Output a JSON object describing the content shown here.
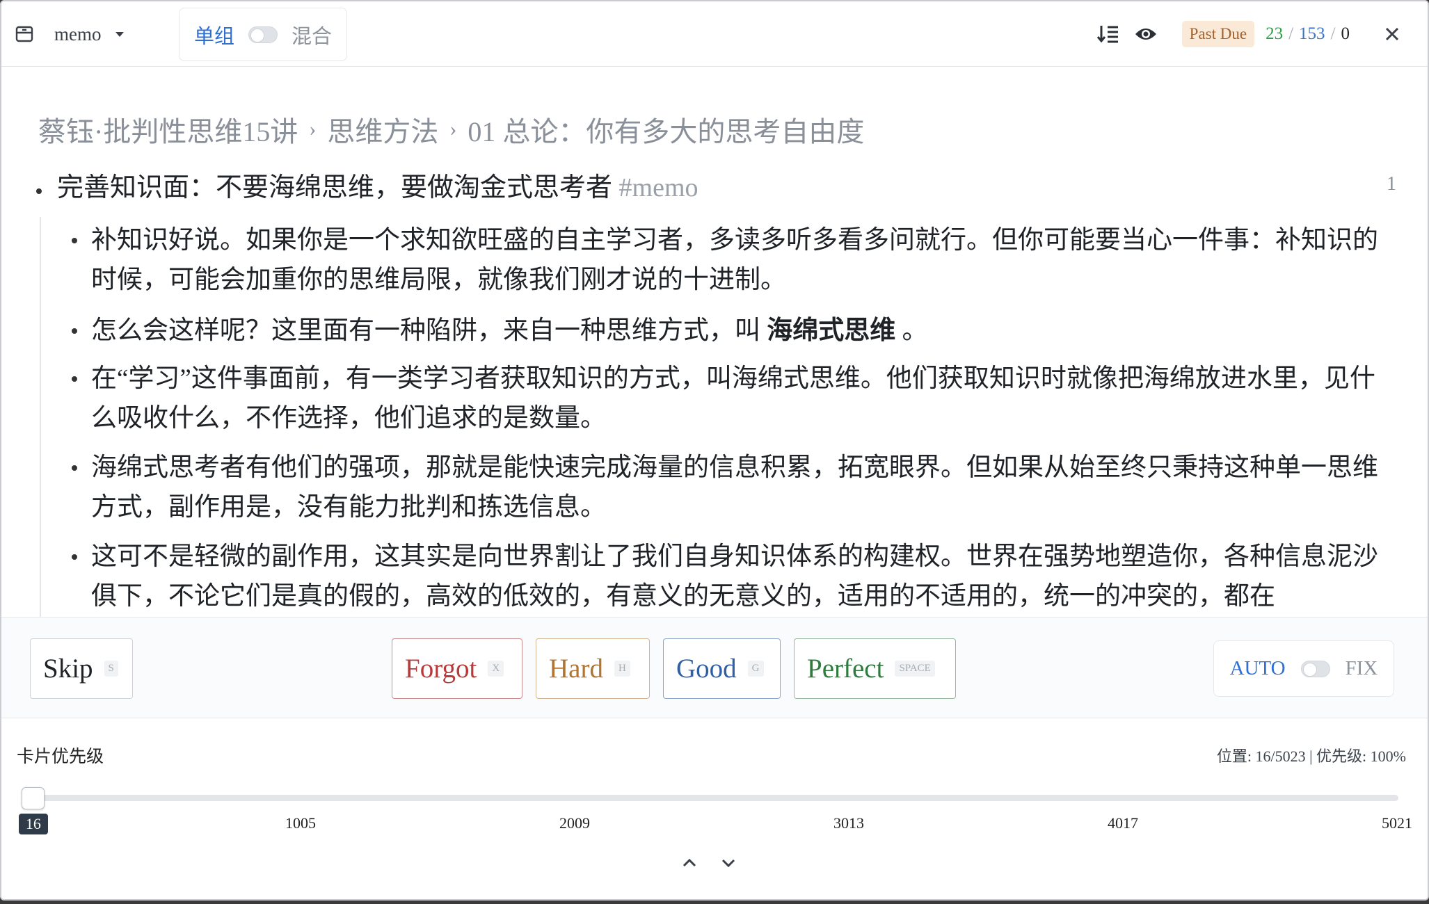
{
  "header": {
    "deck_name": "memo",
    "mode_left": "单组",
    "mode_right": "混合",
    "past_due": "Past Due",
    "count_new": "23",
    "count_sep1": "/",
    "count_due": "153",
    "count_sep2": "/",
    "count_done": "0",
    "icons": [
      "archive-icon",
      "chevron-down-icon",
      "sort-icon",
      "eye-icon",
      "close-icon"
    ]
  },
  "content": {
    "breadcrumb": [
      "蔡钰·批判性思维15讲",
      "思维方法",
      "01 总论：你有多大的思考自由度"
    ],
    "root_text": "完善知识面：不要海绵思维，要做淘金式思考者",
    "root_tag": "#memo",
    "page_number": "1",
    "children": [
      "补知识好说。如果你是一个求知欲旺盛的自主学习者，多读多听多看多问就行。但你可能要当心一件事：补知识的时候，可能会加重你的思维局限，就像我们刚才说的十进制。",
      "怎么会这样呢？这里面有一种陷阱，来自一种思维方式，叫",
      "在“学习”这件事面前，有一类学习者获取知识的方式，叫海绵式思维。他们获取知识时就像把海绵放进水里，见什么吸收什么，不作选择，他们追求的是数量。",
      "海绵式思考者有他们的强项，那就是能快速完成海量的信息积累，拓宽眼界。但如果从始至终只秉持这种单一思维方式，副作用是，没有能力批判和拣选信息。",
      "这可不是轻微的副作用，这其实是向世界割让了我们自身知识体系的构建权。世界在强势地塑造你，各种信息泥沙俱下，不论它们是真的假的，高效的低效的，有意义的无意义的，适用的不适用的，统一的冲突的，都在"
    ],
    "child2_bold": "海绵式思维",
    "child2_end": " 。"
  },
  "actions": {
    "skip": {
      "label": "Skip",
      "key": "S"
    },
    "forgot": {
      "label": "Forgot",
      "key": "X"
    },
    "hard": {
      "label": "Hard",
      "key": "H"
    },
    "good": {
      "label": "Good",
      "key": "G"
    },
    "perfect": {
      "label": "Perfect",
      "key": "SPACE"
    },
    "auto_left": "AUTO",
    "auto_right": "FIX"
  },
  "priority": {
    "title": "卡片优先级",
    "info": "位置: 16/5023 | 优先级: 100%",
    "value": 16,
    "min": 1,
    "max": 5021,
    "ticks": [
      "1005",
      "2009",
      "3013",
      "4017",
      "5021"
    ],
    "handle_label": "16"
  }
}
